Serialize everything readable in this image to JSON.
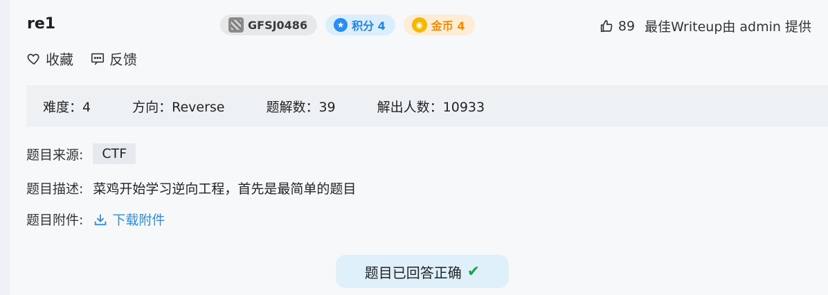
{
  "challenge": {
    "title": "re1",
    "badges": {
      "id": "GFSJ0486",
      "score": "积分 4",
      "coins": "金币 4"
    },
    "likes": "89",
    "writeup": "最佳Writeup由 admin 提供",
    "actions": {
      "favorite": "收藏",
      "feedback": "反馈"
    },
    "stats": {
      "difficulty": "难度：4",
      "direction": "方向：Reverse",
      "solves": "题解数：39",
      "solvers": "解出人数：10933"
    },
    "source_label": "题目来源:",
    "source_value": "CTF",
    "desc_label": "题目描述:",
    "desc_value": "菜鸡开始学习逆向工程，首先是最简单的题目",
    "attach_label": "题目附件:",
    "attach_value": "下载附件",
    "status": "题目已回答正确"
  },
  "colors": {
    "accent_blue": "#2e8be6",
    "score_blue": "#2383e2",
    "coin_orange": "#f08c00",
    "success_green": "#1aa34a"
  },
  "icons": [
    "grid-avatar-icon",
    "score-icon",
    "coin-icon",
    "thumbs-up-icon",
    "heart-icon",
    "feedback-icon",
    "download-icon",
    "check-icon"
  ]
}
